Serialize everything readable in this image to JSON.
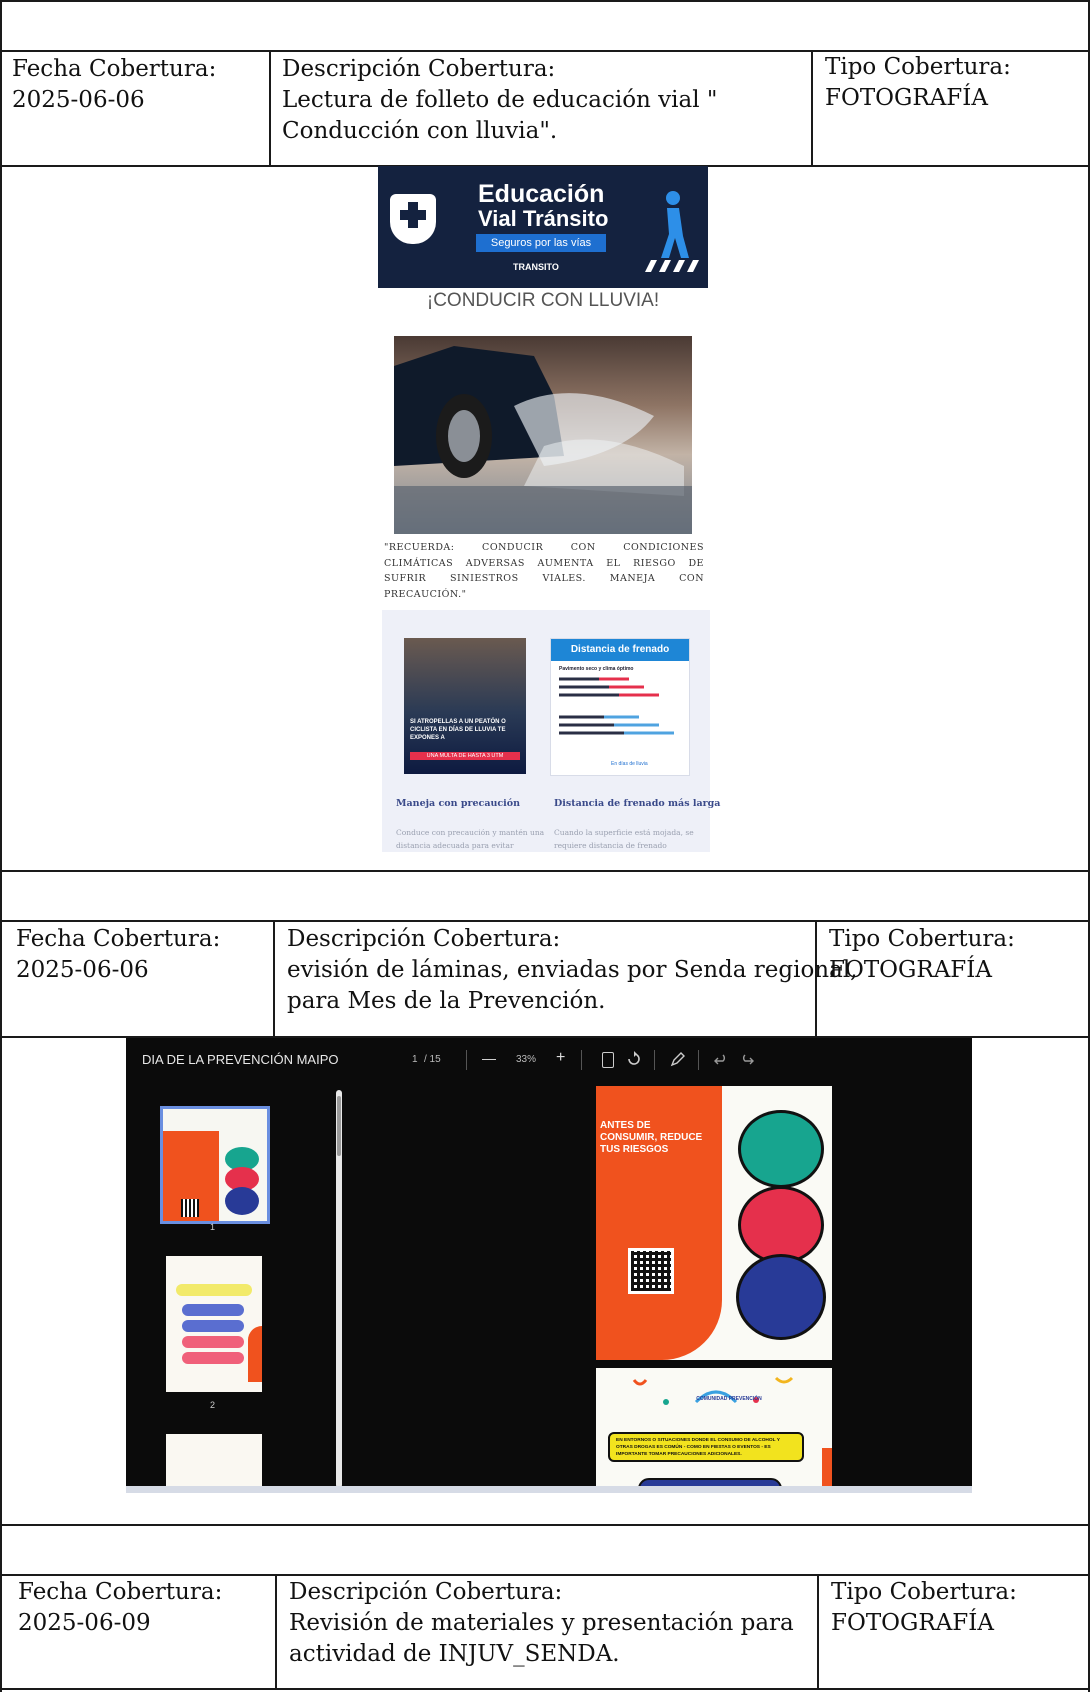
{
  "sections": [
    {
      "fecha_label": "Fecha Cobertura:",
      "fecha": "2025-06-06",
      "desc_label": "Descripción Cobertura:",
      "desc_lines": [
        "Lectura de folleto de educación vial \"",
        "Conducción con lluvia\"."
      ],
      "tipo_label": "Tipo Cobertura:",
      "tipo": "FOTOGRAFÍA"
    },
    {
      "fecha_label": "Fecha Cobertura:",
      "fecha": "2025-06-06",
      "desc_label": "Descripción Cobertura:",
      "desc_lines": [
        "evisión de láminas, enviadas por Senda regional,",
        "para Mes de la Prevención."
      ],
      "tipo_label": "Tipo Cobertura:",
      "tipo": "FOTOGRAFÍA"
    },
    {
      "fecha_label": "Fecha Cobertura:",
      "fecha": "2025-06-09",
      "desc_label": "Descripción Cobertura:",
      "desc_lines": [
        "Revisión de materiales y presentación para",
        "actividad de INJUV_SENDA."
      ],
      "tipo_label": "Tipo Cobertura:",
      "tipo": "FOTOGRAFÍA"
    }
  ],
  "flyer": {
    "banner_title_1": "Educación",
    "banner_title_2": "Vial Tránsito",
    "banner_tagline": "Seguros por las vías",
    "banner_brand": "TRANSITO",
    "heading": "¡CONDUCIR CON LLUVIA!",
    "quote": "\"RECUERDA: CONDUCIR CON CONDICIONES CLIMÁTICAS ADVERSAS AUMENTA EL RIESGO DE SUFRIR SINIESTROS VIALES. MANEJA CON PRECAUCIÓN.\"",
    "card1_overlay": "SI ATROPELLAS A UN PEATÓN O CICLISTA EN DÍAS DE LLUVIA TE EXPONES A",
    "card1_overlay_strip": "UNA MULTA DE HASTA 3 UTM",
    "card1_title": "Maneja con precaución",
    "card1_text": "Conduce con precaución y mantén una distancia adecuada para evitar",
    "card2_header": "Distancia de frenado",
    "card2_sub": "Pavimento seco y clima óptimo",
    "card2_footer": "En días de lluvia",
    "card2_title": "Distancia de frenado más larga",
    "card2_text": "Cuando la superficie está mojada, se requiere distancia de frenado"
  },
  "viewer": {
    "title": "DIA DE LA PREVENCIÓN MAIPO",
    "page_current": "1",
    "page_total": "/ 15",
    "zoom_minus": "—",
    "zoom": "33%",
    "zoom_plus": "+",
    "thumb_labels": [
      "1",
      "2"
    ],
    "slide1_title": "ANTES DE CONSUMIR, REDUCE TUS RIESGOS",
    "slide2_brand": "COMUNIDAD PREVENCIÓN",
    "slide2_box": "EN ENTORNOS O SITUACIONES DONDE EL CONSUMO DE ALCOHOL Y OTRAS DROGAS ES COMÚN - COMO EN FIESTAS O EVENTOS - ES IMPORTANTE TOMAR PRECAUCIONES ADICIONALES."
  },
  "colors": {
    "banner_bg": "#14223f",
    "accent_blue": "#1e6fd0",
    "slide_orange": "#f0521e",
    "circle_teal": "#17a58f",
    "circle_red": "#e5304c",
    "circle_navy": "#283a97",
    "viewer_bg": "#0b0b0b"
  }
}
